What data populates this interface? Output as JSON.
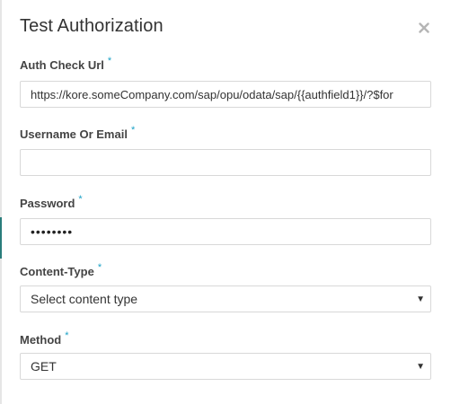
{
  "dialog": {
    "title": "Test Authorization",
    "close_icon": "close-icon"
  },
  "fields": {
    "auth_check_url": {
      "label": "Auth Check Url",
      "required_mark": "*",
      "value": "https://kore.someCompany.com/sap/opu/odata/sap/{{authfield1}}/?$for"
    },
    "username": {
      "label": "Username Or Email",
      "required_mark": "*",
      "value": ""
    },
    "password": {
      "label": "Password",
      "required_mark": "*",
      "value": "••••••••"
    },
    "content_type": {
      "label": "Content-Type",
      "required_mark": "*",
      "selected": "Select content type",
      "caret_icon": "caret-down-icon"
    },
    "method": {
      "label": "Method",
      "required_mark": "*",
      "selected": "GET",
      "caret_icon": "caret-down-icon"
    }
  },
  "colors": {
    "required": "#1ba1c6",
    "accent_edge": "#2a7d7b",
    "border": "#d8d8d8"
  }
}
